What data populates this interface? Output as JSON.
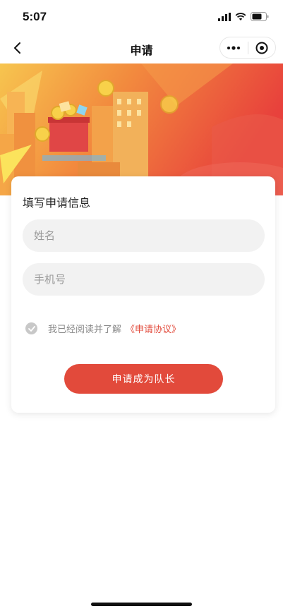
{
  "status_bar": {
    "time": "5:07"
  },
  "nav": {
    "title": "申请"
  },
  "form": {
    "title": "填写申请信息",
    "name_placeholder": "姓名",
    "phone_placeholder": "手机号",
    "agree_text": "我已经阅读并了解",
    "agreement_link": "《申请协议》",
    "submit_label": "申请成为队长"
  },
  "colors": {
    "accent": "#e24a3b",
    "banner_start": "#f7c54f",
    "banner_end": "#e8413c"
  }
}
